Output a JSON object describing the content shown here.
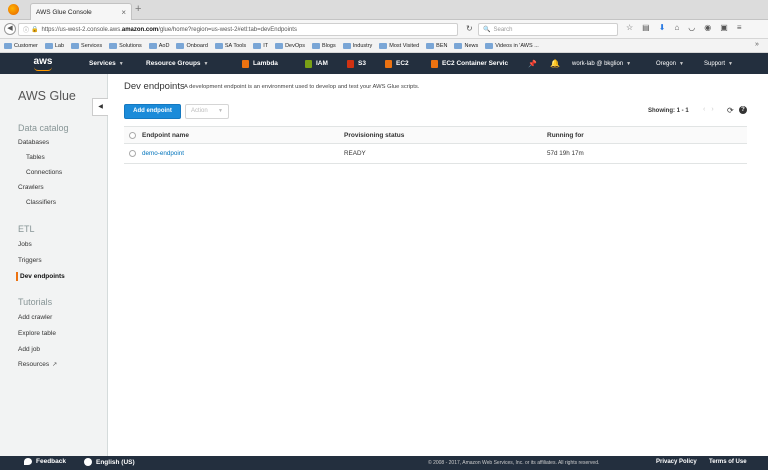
{
  "browser": {
    "tab_title": "AWS Glue Console",
    "tab_close": "×",
    "tab_add": "+",
    "url_prefix": "https://us-west-2.console.aws.",
    "url_domain": "amazon.com",
    "url_path": "/glue/home?region=us-west-2#etl:tab=devEndpoints",
    "search_placeholder": "Search",
    "bookmarks": [
      "Customer",
      "Lab",
      "Services",
      "Solutions",
      "AoD",
      "Onboard",
      "SA Tools",
      "IT",
      "DevOps",
      "Blogs",
      "Industry",
      "Most Visited",
      "BEN",
      "News",
      "Videos in 'AWS ..."
    ],
    "bookmarks_more": "»"
  },
  "aws_header": {
    "logo": "aws",
    "services": "Services",
    "resource_groups": "Resource Groups",
    "shortcuts": [
      {
        "label": "Lambda",
        "color": "#ec7211"
      },
      {
        "label": "IAM",
        "color": "#7aa116"
      },
      {
        "label": "S3",
        "color": "#d13212"
      },
      {
        "label": "EC2",
        "color": "#ec7211"
      },
      {
        "label": "EC2 Container Servic",
        "color": "#ec7211"
      }
    ],
    "account": "work-lab @ bkglion",
    "region": "Oregon",
    "support": "Support"
  },
  "sidebar": {
    "title": "AWS Glue",
    "sections": [
      {
        "title": "Data catalog",
        "items": [
          "Databases",
          "Tables",
          "Connections",
          "Crawlers",
          "Classifiers"
        ]
      },
      {
        "title": "ETL",
        "items": [
          "Jobs",
          "Triggers",
          "Dev endpoints"
        ]
      },
      {
        "title": "Tutorials",
        "items": [
          "Add crawler",
          "Explore table",
          "Add job",
          "Resources"
        ]
      }
    ]
  },
  "main": {
    "title": "Dev endpoints",
    "description": "A development endpoint is an environment used to develop and test your AWS Glue scripts.",
    "add_button": "Add endpoint",
    "action_button": "Action",
    "showing": "Showing: 1 - 1",
    "columns": [
      "Endpoint name",
      "Provisioning status",
      "Running for"
    ],
    "rows": [
      {
        "name": "demo-endpoint",
        "status": "READY",
        "running_for": "57d 19h 17m"
      }
    ]
  },
  "footer": {
    "feedback": "Feedback",
    "language": "English (US)",
    "copyright": "© 2008 - 2017, Amazon Web Services, Inc. or its affiliates. All rights reserved.",
    "privacy": "Privacy Policy",
    "terms": "Terms of Use"
  }
}
